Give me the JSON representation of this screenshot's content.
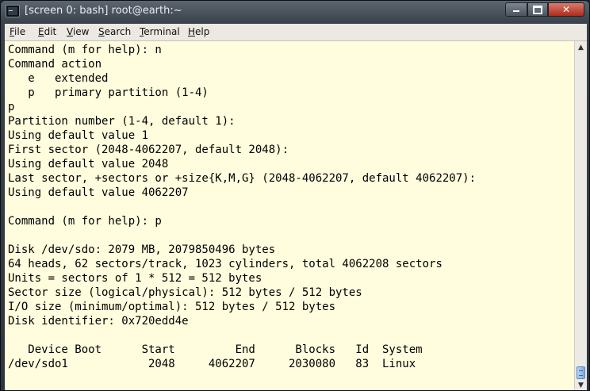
{
  "window": {
    "title": "[screen 0: bash] root@earth:~",
    "icons": [
      "terminal-icon",
      "minimize-icon",
      "maximize-icon",
      "close-icon"
    ]
  },
  "menubar": {
    "items": [
      {
        "label": "File",
        "mnemonic": "F",
        "rest": "ile"
      },
      {
        "label": "Edit",
        "mnemonic": "E",
        "rest": "dit"
      },
      {
        "label": "View",
        "mnemonic": "V",
        "rest": "iew"
      },
      {
        "label": "Search",
        "mnemonic": "S",
        "rest": "earch"
      },
      {
        "label": "Terminal",
        "mnemonic": "T",
        "rest": "erminal"
      },
      {
        "label": "Help",
        "mnemonic": "H",
        "rest": "elp"
      }
    ]
  },
  "terminal": {
    "lines": [
      "Command (m for help): n",
      "Command action",
      "   e   extended",
      "   p   primary partition (1-4)",
      "p",
      "Partition number (1-4, default 1):",
      "Using default value 1",
      "First sector (2048-4062207, default 2048):",
      "Using default value 2048",
      "Last sector, +sectors or +size{K,M,G} (2048-4062207, default 4062207):",
      "Using default value 4062207",
      "",
      "Command (m for help): p",
      "",
      "Disk /dev/sdo: 2079 MB, 2079850496 bytes",
      "64 heads, 62 sectors/track, 1023 cylinders, total 4062208 sectors",
      "Units = sectors of 1 * 512 = 512 bytes",
      "Sector size (logical/physical): 512 bytes / 512 bytes",
      "I/O size (minimum/optimal): 512 bytes / 512 bytes",
      "Disk identifier: 0x720edd4e",
      "",
      "   Device Boot      Start         End      Blocks   Id  System",
      "/dev/sdo1            2048     4062207     2030080   83  Linux"
    ]
  },
  "colors": {
    "terminal_background": "#fffdde",
    "terminal_foreground": "#000000",
    "scrollbar_thumb": "#7ea9de"
  }
}
